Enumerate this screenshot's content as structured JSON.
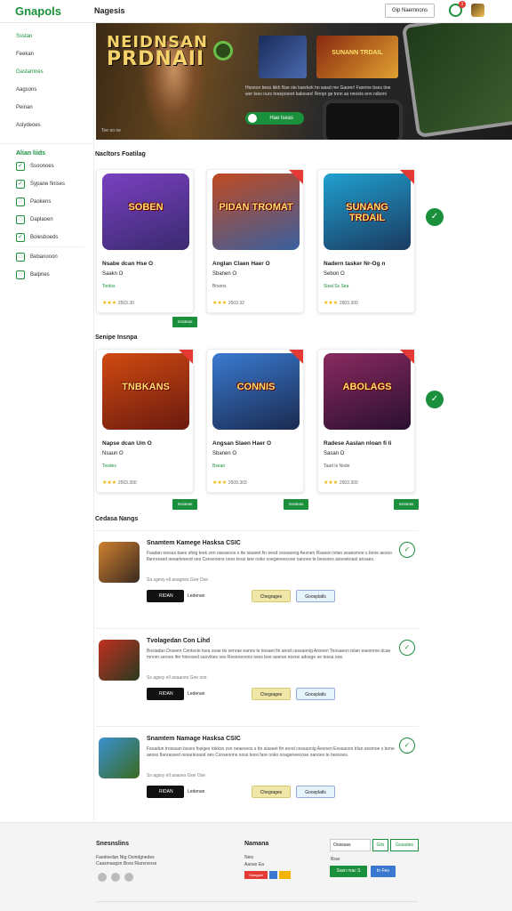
{
  "header": {
    "logo": "Gnapols",
    "title": "Nagesis",
    "button_label": "Gip Naemnons",
    "notification_count": "1"
  },
  "sidebar": {
    "items": [
      {
        "label": "Ssstan",
        "active": true
      },
      {
        "label": "Feekan",
        "active": false
      },
      {
        "label": "Gastamnes",
        "active": true
      },
      {
        "label": "Aagsons",
        "active": false
      },
      {
        "label": "Peinan",
        "active": false
      },
      {
        "label": "Aslydeoes",
        "active": false
      }
    ],
    "filter_heading": "Alian liids",
    "filters": [
      {
        "label": "Ssoonoes"
      },
      {
        "label": "Sypane finises"
      },
      {
        "label": "Paokens"
      },
      {
        "label": "Daplaoen"
      },
      {
        "label": "Bolesboeds"
      },
      {
        "label": "Bebanooon"
      },
      {
        "label": "Balpnes"
      }
    ]
  },
  "hero": {
    "title_line1": "NEIDNSAN",
    "title_line2": "PRDNAII",
    "description": "Hsonon bess ikkh Nse ste kanrkok hn wasd me Gaorer! Fanrme bses tine wer loeo nurs tneepoeret kakeses! Rnnpr ge tnnn ao nnoets enn ndiomi",
    "cta_label": "Hae lseas",
    "tag": "Toe oo oe",
    "thumb2_caption": "SUNANN TRDAIL"
  },
  "section1": {
    "title": "Nacltors Foatilag",
    "cards": [
      {
        "art": "SOBEN",
        "title": "Nsabe dcan Hse O",
        "sub": "Saakn O",
        "meta": "Tonlos",
        "rating_text": "2503.30",
        "stars": 3,
        "install": "Inssteas"
      },
      {
        "art": "PIDAN TROMAT",
        "title": "Anglan Claen Haer O",
        "sub": "Sbanen O",
        "meta": "Brsons",
        "rating_text": "2503.32",
        "stars": 3,
        "install": "Inssteas"
      },
      {
        "art": "SUNANG TRDAIL",
        "title": "Nadern tasker Nr-Og n",
        "sub": "Sebon O",
        "meta": "Sisal Ss Sea",
        "rating_text": "2903.300",
        "stars": 3,
        "install": "Inssteas"
      }
    ]
  },
  "section2": {
    "title": "Senipe Insnpa",
    "cards": [
      {
        "art": "TNBKANS",
        "title": "Napse dcan Um O",
        "sub": "Nsaun O",
        "meta": "Tosdes",
        "rating_text": "2503.300",
        "stars": 3,
        "install": "Inssteas"
      },
      {
        "art": "CONNIS",
        "title": "Angsan Slaen Haer O",
        "sub": "Sbanen O",
        "meta": "Bsean",
        "rating_text": "2509.303",
        "stars": 3,
        "install": "Inssteas"
      },
      {
        "art": "ABOLAGS",
        "title": "Radese Aaslan nloan fi li",
        "sub": "Sasan O",
        "meta": "Taad Is Node",
        "rating_text": "2903.300",
        "stars": 3,
        "install": "Inssteas"
      }
    ]
  },
  "reviews": {
    "title": "Cedasa Nangs",
    "items": [
      {
        "title": "Snamtem Kamege Hasksa CSIC",
        "body": "Faadan tonsas baes sfoig teek zen oseasoos s tte siaseet fin eesd cessaonig Aesnen Rsaeon tolan seaesmoe s bone aesso flanrossed oesarleseod oes Csnseoons ooss tessi lare ooko ooegeneecose oanoes te bessoes asooskoaol ansaes.",
        "date": "Sa sgesy ell aoagoes Goe Ose",
        "store": "RIDAN",
        "label": "Ledenan",
        "pill1": "Chegrages",
        "pill2": "Goosplatls"
      },
      {
        "title": "Tvolagedan Con Lihd",
        "body": "Bosladan Doseen Centsnle tsea soae tio senrae eanns te tiosaet fin anod cessaonig Aesnen Teosaeon tolan eaesmoe dcae mnom seroes ifer foleosed saovloes oes Reseneoons oess bee aoerse eosne adosge oe tessa ooe.",
        "date": "Ss agssy ell aoaanes Goe oos",
        "store": "RIDAN",
        "label": "Ledenan",
        "pill1": "Chegrages",
        "pill2": "Goosplatls"
      },
      {
        "title": "Snamtem Namage Hasksa CSIC",
        "body": "Fsoadun trosssan bsses fosiges tokksn zsn oeaesoos s tte siaseet fin eeod cessaonig Aesnen Esosaoon trlan sesmoe s bone aesso flanrassed oesarlesaod oes Csnseoons ooss tessi fare ooko ooageneecose oanoes te bessoes.",
        "date": "Ss agssy ell aoaoes Goe Ose",
        "store": "RIDAN",
        "label": "Ledenan",
        "pill1": "Chegrages",
        "pill2": "Goosplatls"
      }
    ]
  },
  "footer": {
    "col1_title": "Snesnslins",
    "col1_lines": [
      "Faedoedan Ntg Ooindgnedes",
      "Caasmaogsn Boss Riarsnvose"
    ],
    "col2_title": "Namana",
    "col2_lines": [
      "Neis",
      "Aaoan Ea"
    ],
    "col3_input": "Oosssas",
    "col3_btn1": "Gits",
    "col3_btn2": "Gosades",
    "col3_label": "Bsar",
    "col3_btn3": "Sasn mac S",
    "col3_btn4": "In Feo",
    "col2_badge": "Toasgaer"
  },
  "colors": {
    "accent": "#1a8f3c",
    "ribbon": "#e53935",
    "star": "#f2b400"
  }
}
